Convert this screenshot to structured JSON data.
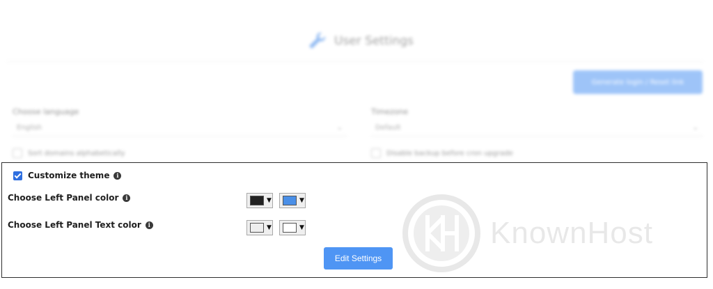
{
  "background": {
    "title": "User Settings",
    "top_button": "Generate login / Reset link",
    "fields": [
      {
        "label": "Choose language",
        "value": "English"
      },
      {
        "label": "Timezone",
        "value": "Default"
      }
    ],
    "checks": [
      "Sort domains alphabetically",
      "Disable backup before cron upgrade"
    ]
  },
  "panel": {
    "customize_label": "Customize theme",
    "left_panel_color_label": "Choose Left Panel color",
    "left_panel_text_color_label": "Choose Left Panel Text color",
    "edit_button": "Edit Settings"
  },
  "colors": {
    "left_panel_bg": "#222222",
    "left_panel_accent": "#4a8fe7",
    "left_panel_text_1": "#eeeeee",
    "left_panel_text_2": "#ffffff",
    "primary": "#4f95f4"
  },
  "watermark": {
    "text": "KnownHost",
    "logo_letters": "KH"
  }
}
